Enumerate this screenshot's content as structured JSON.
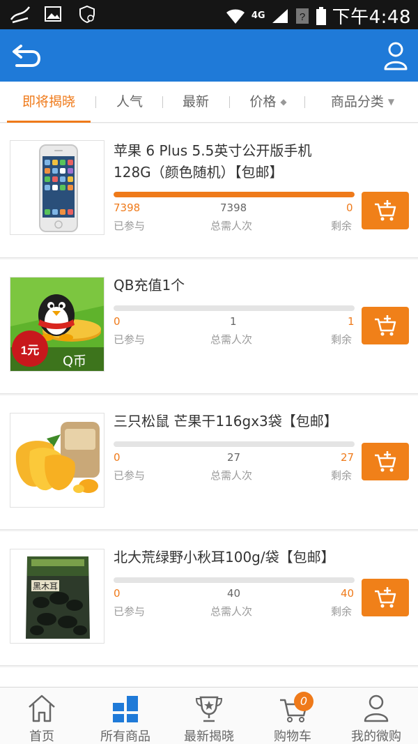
{
  "status_bar": {
    "network": "4G",
    "time": "下午4:48"
  },
  "tabs": [
    {
      "label": "即将揭晓",
      "active": true
    },
    {
      "label": "人气"
    },
    {
      "label": "最新"
    },
    {
      "label": "价格",
      "suffix": "◆"
    },
    {
      "label": "商品分类",
      "suffix": "▼"
    }
  ],
  "labels": {
    "joined": "已参与",
    "total": "总需人次",
    "remaining": "剩余"
  },
  "products": [
    {
      "title": "苹果 6 Plus 5.5英寸公开版手机 128G（颜色随机）【包邮】",
      "joined": "7398",
      "total": "7398",
      "remaining": "0",
      "progress": 1.0,
      "thumb": "iphone"
    },
    {
      "title": "QB充值1个",
      "joined": "0",
      "total": "1",
      "remaining": "1",
      "progress": 0.0,
      "thumb": "qq",
      "thumb_badge": "1元",
      "thumb_caption": "Q币"
    },
    {
      "title": "三只松鼠 芒果干116gx3袋【包邮】",
      "joined": "0",
      "total": "27",
      "remaining": "27",
      "progress": 0.0,
      "thumb": "mango"
    },
    {
      "title": "北大荒绿野小秋耳100g/袋【包邮】",
      "joined": "0",
      "total": "40",
      "remaining": "40",
      "progress": 0.0,
      "thumb": "fungus",
      "thumb_text": "黑木耳"
    }
  ],
  "bottom_nav": [
    {
      "label": "首页",
      "icon": "home-icon"
    },
    {
      "label": "所有商品",
      "icon": "grid-icon",
      "active": true
    },
    {
      "label": "最新揭晓",
      "icon": "trophy-icon"
    },
    {
      "label": "购物车",
      "icon": "cart-icon",
      "badge": "0"
    },
    {
      "label": "我的微购",
      "icon": "person-icon"
    }
  ],
  "colors": {
    "header": "#1f7ad8",
    "accent": "#ef7a1a",
    "nav_active": "#1f7ad8"
  }
}
